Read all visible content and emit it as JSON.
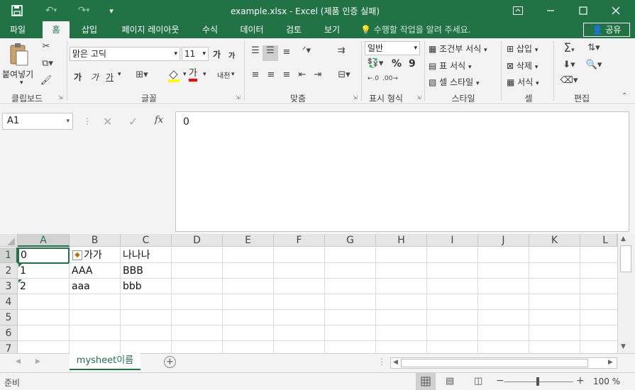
{
  "titlebar": {
    "title": "example.xlsx - Excel (제품 인증 실패)",
    "icons": [
      "save-icon",
      "undo-icon",
      "redo-icon",
      "customize-qat-icon",
      "ribbon-display-icon",
      "minimize-icon",
      "maximize-icon",
      "close-icon"
    ]
  },
  "tabs": [
    "파일",
    "홈",
    "삽입",
    "페이지 레이아웃",
    "수식",
    "데이터",
    "검토",
    "보기"
  ],
  "active_tab": "홈",
  "tellme": "수행할 작업을 알려 주세요.",
  "share_label": "공유",
  "ribbon": {
    "clipboard": {
      "paste_label": "붙여넣기",
      "group": "클립보드"
    },
    "font": {
      "font_name": "맑은 고딕",
      "font_size": "11",
      "bold": "가",
      "italic": "가",
      "underline": "가",
      "grow": "가",
      "shrink": "가",
      "font_color_glyph": "가",
      "phonetic": "내천",
      "group": "글꼴"
    },
    "alignment": {
      "group": "맞춤"
    },
    "number": {
      "format": "일반",
      "percent": "%",
      "comma": "9",
      "group": "표시 형식"
    },
    "styles": {
      "conditional": "조건부 서식",
      "table": "표 서식",
      "cell_styles": "셀 스타일",
      "group": "스타일"
    },
    "cells": {
      "insert": "삽입",
      "delete": "삭제",
      "format": "서식",
      "group": "셀"
    },
    "editing": {
      "group": "편집"
    }
  },
  "formula_bar": {
    "name_box": "A1",
    "fx": "fx",
    "value": "0"
  },
  "grid": {
    "columns": [
      "A",
      "B",
      "C",
      "D",
      "E",
      "F",
      "G",
      "H",
      "I",
      "J",
      "K",
      "L"
    ],
    "rows": [
      "1",
      "2",
      "3",
      "4",
      "5",
      "6",
      "7"
    ],
    "cells": [
      [
        "0",
        "가가",
        "나나나"
      ],
      [
        "1",
        "AAA",
        "BBB"
      ],
      [
        "2",
        "aaa",
        "bbb"
      ]
    ]
  },
  "sheet_tab": "mysheet이름",
  "status": {
    "ready": "준비",
    "zoom": "100 %"
  },
  "accent_color": "#217346"
}
